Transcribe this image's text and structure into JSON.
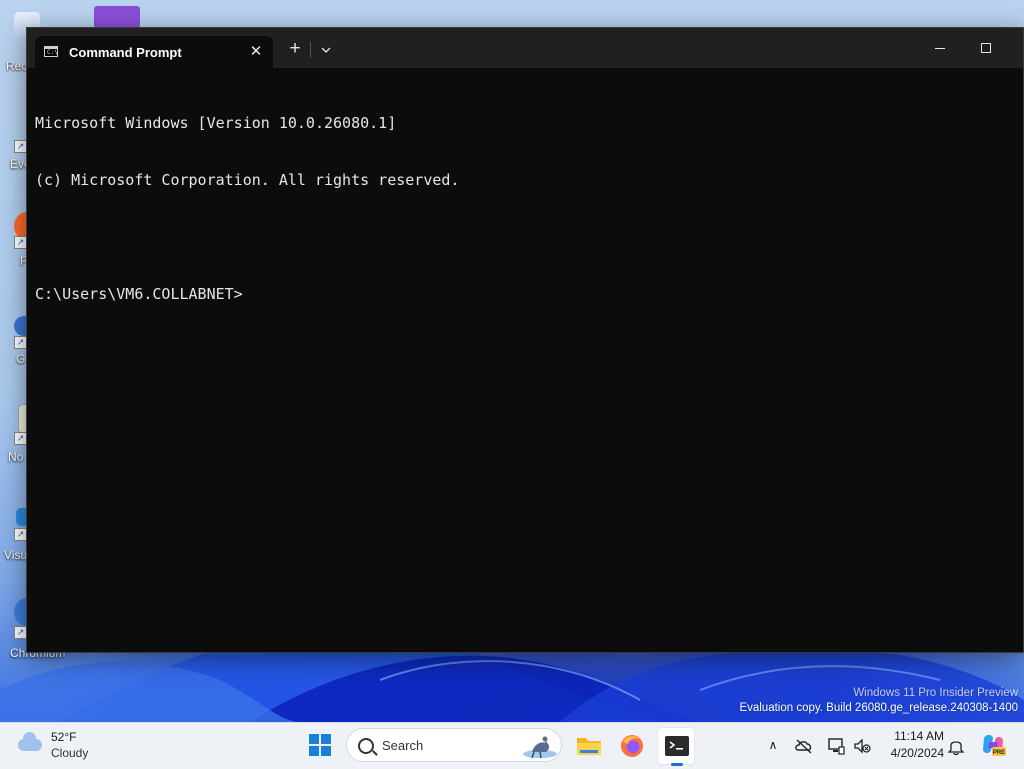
{
  "desktop": {
    "icons": [
      {
        "name": "recycle-bin",
        "label": "Rec"
      },
      {
        "name": "everything",
        "label": "Eve"
      },
      {
        "name": "firefox",
        "label": "F"
      },
      {
        "name": "git",
        "label": "G"
      },
      {
        "name": "notepad",
        "label": "No"
      },
      {
        "name": "visual-studio-code",
        "label": "Visu"
      },
      {
        "name": "chromium",
        "label": "Chromium"
      }
    ],
    "watermark": {
      "line1": "Windows 11 Pro Insider Preview",
      "line2": "Evaluation copy. Build 26080.ge_release.240308-1400"
    }
  },
  "window": {
    "tab_title": "Command Prompt",
    "close_tab_glyph": "✕",
    "new_tab_glyph": "+",
    "dropdown_glyph": "⌄",
    "console_lines": [
      "Microsoft Windows [Version 10.0.26080.1]",
      "(c) Microsoft Corporation. All rights reserved.",
      "",
      "C:\\Users\\VM6.COLLABNET>"
    ]
  },
  "taskbar": {
    "weather": {
      "temp": "52°F",
      "condition": "Cloudy"
    },
    "search_placeholder": "Search",
    "tray_chevron": "∧",
    "time": "11:14 AM",
    "date": "4/20/2024"
  },
  "colors": {
    "console_bg": "#0c0c0c",
    "titlebar_bg": "#202020",
    "taskbar_bg": "#eef1f6",
    "accent": "#1a7fd9"
  }
}
